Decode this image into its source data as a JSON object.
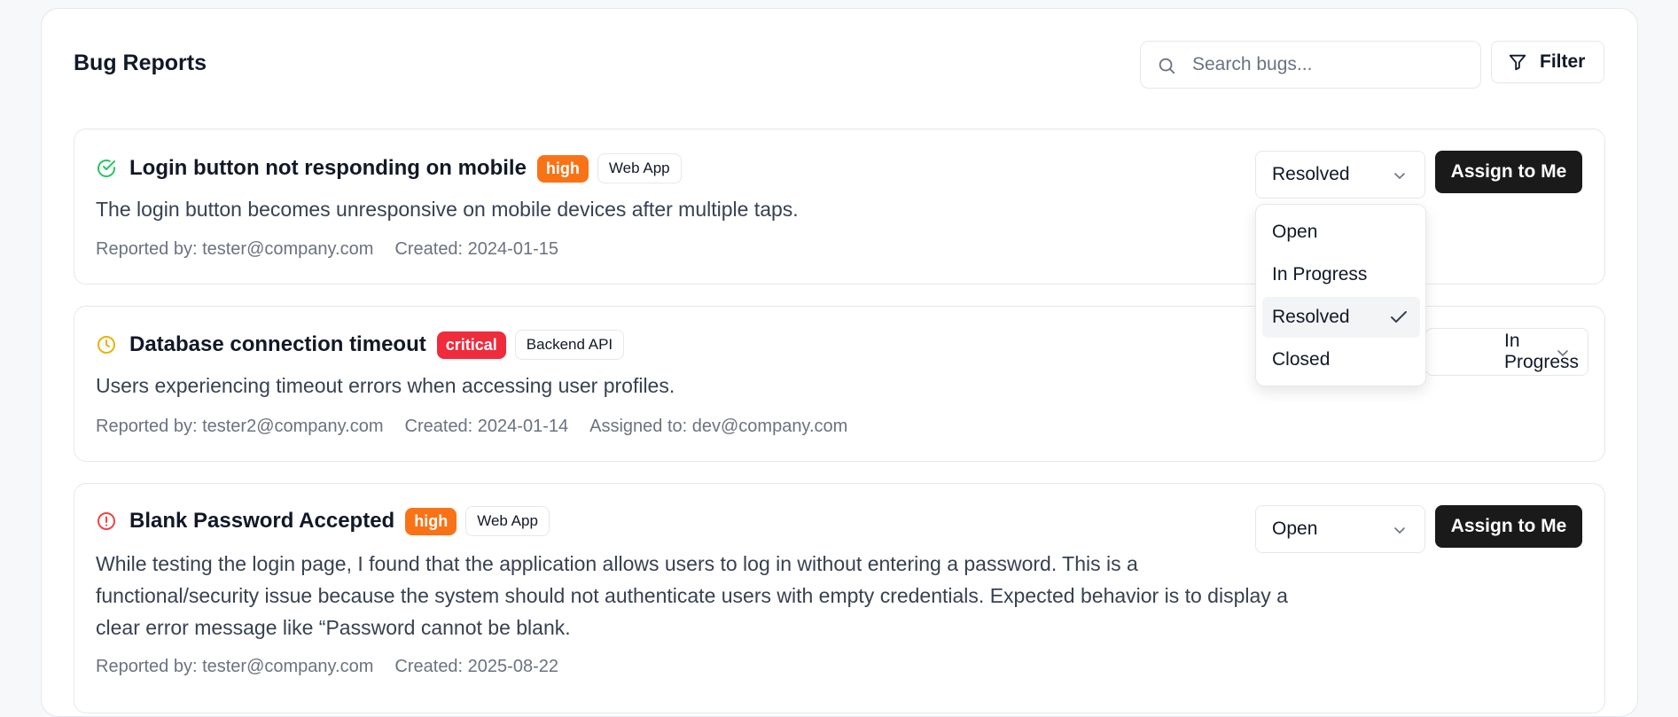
{
  "header": {
    "title": "Bug Reports",
    "search_placeholder": "Search bugs...",
    "filter_label": "Filter"
  },
  "colors": {
    "high": "#f97316",
    "critical": "#ef2b3c",
    "resolved_icon": "#22c55e",
    "in_progress_icon": "#eab308",
    "open_icon": "#ef4444",
    "primary_button": "#1a1a1a"
  },
  "bugs": [
    {
      "status_icon": "check-circle-icon",
      "title": "Login button not responding on mobile",
      "severity": "high",
      "project": "Web App",
      "description": "The login button becomes unresponsive on mobile devices after multiple taps.",
      "reporter": "Reported by: tester@company.com",
      "created": "Created: 2024-01-15",
      "status": "Resolved",
      "assign_label": "Assign to Me"
    },
    {
      "status_icon": "clock-icon",
      "title": "Database connection timeout",
      "severity": "critical",
      "project": "Backend API",
      "description": "Users experiencing timeout errors when accessing user profiles.",
      "reporter": "Reported by: tester2@company.com",
      "created": "Created: 2024-01-14",
      "assigned": "Assigned to: dev@company.com",
      "status": "In Progress"
    },
    {
      "status_icon": "alert-circle-icon",
      "title": "Blank Password Accepted",
      "severity": "high",
      "project": "Web App",
      "description": "While testing the login page, I found that the application allows users to log in without entering a password. This is a functional/security issue because the system should not authenticate users with empty credentials. Expected behavior is to display a clear error message like “Password cannot be blank.",
      "reporter": "Reported by: tester@company.com",
      "created": "Created: 2025-08-22",
      "status": "Open",
      "assign_label": "Assign to Me"
    }
  ],
  "status_dropdown": {
    "options": [
      "Open",
      "In Progress",
      "Resolved",
      "Closed"
    ],
    "selected": "Resolved"
  }
}
